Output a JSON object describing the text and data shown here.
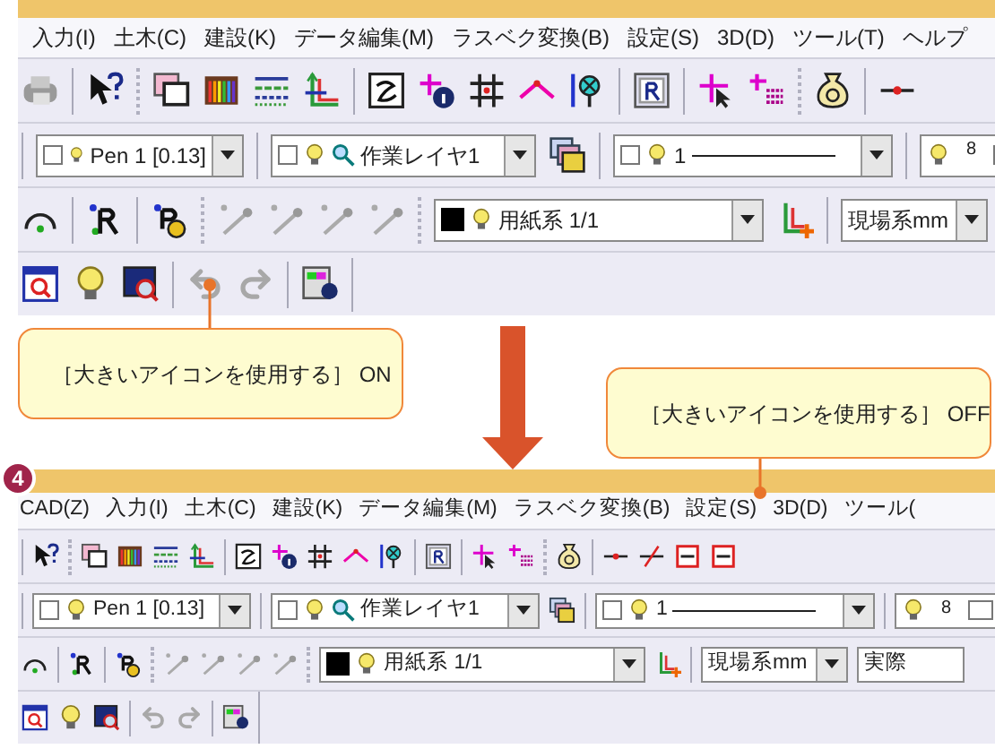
{
  "panels": [
    {
      "kind": "large",
      "menu": [
        "入力(I)",
        "土木(C)",
        "建設(K)",
        "データ編集(M)",
        "ラスベク変換(B)",
        "設定(S)",
        "3D(D)",
        "ツール(T)",
        "ヘルプ"
      ],
      "combos": [
        {
          "kind": "pen",
          "checked": false,
          "text": "Pen 1 [0.13]"
        },
        {
          "kind": "layer",
          "checked": false,
          "text": "作業レイヤ1"
        },
        {
          "kind": "line",
          "checked": false,
          "text": "1"
        },
        {
          "kind": "value",
          "text": "8"
        },
        {
          "kind": "paper",
          "text": "用紙系 1/1"
        },
        {
          "kind": "unit",
          "text": "現場系mm"
        }
      ]
    },
    {
      "kind": "small",
      "step_badge": "4",
      "menu": [
        "CAD(Z)",
        "入力(I)",
        "土木(C)",
        "建設(K)",
        "データ編集(M)",
        "ラスベク変換(B)",
        "設定(S)",
        "3D(D)",
        "ツール("
      ],
      "combos": [
        {
          "kind": "pen",
          "checked": false,
          "text": "Pen 1 [0.13]"
        },
        {
          "kind": "layer",
          "checked": false,
          "text": "作業レイヤ1"
        },
        {
          "kind": "line",
          "checked": false,
          "text": "1"
        },
        {
          "kind": "value",
          "text": "8"
        },
        {
          "kind": "paper",
          "text": "用紙系 1/1"
        },
        {
          "kind": "unit",
          "text": "現場系mm"
        },
        {
          "kind": "scale",
          "text": "実際"
        }
      ]
    }
  ],
  "callouts": [
    {
      "text": "［大きいアイコンを使用する］ ON"
    },
    {
      "text": "［大きいアイコンを使用する］ OFF"
    }
  ]
}
